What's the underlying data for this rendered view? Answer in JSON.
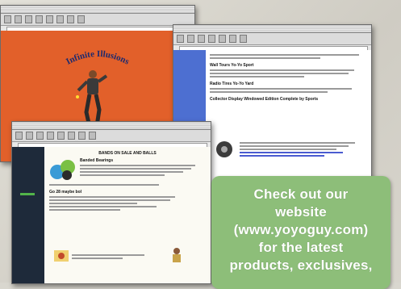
{
  "windows": {
    "back": {
      "title": "Infinite Illusions",
      "heading": "Infinite Illusions"
    },
    "middle": {
      "title": "",
      "headings": [
        "Wall Tours Yo-Yo Sport",
        "Radio Tires Yo-Yo Yard",
        "Collector Display Windowed Edition Complete by Sports"
      ]
    },
    "front": {
      "title": "",
      "headings": [
        "BANDS ON SALE AND BALLS",
        "Banded Bearings",
        "Go 28 maybe bol"
      ]
    }
  },
  "callout": {
    "lines": [
      "Check out our",
      "website",
      "(www.yoyoguy.com)",
      "for the latest",
      "products, exclusives,"
    ]
  },
  "colors": {
    "orange_page": "#e2602a",
    "blue_sidebar": "#4d6fd1",
    "callout_green": "#8dbe79"
  }
}
